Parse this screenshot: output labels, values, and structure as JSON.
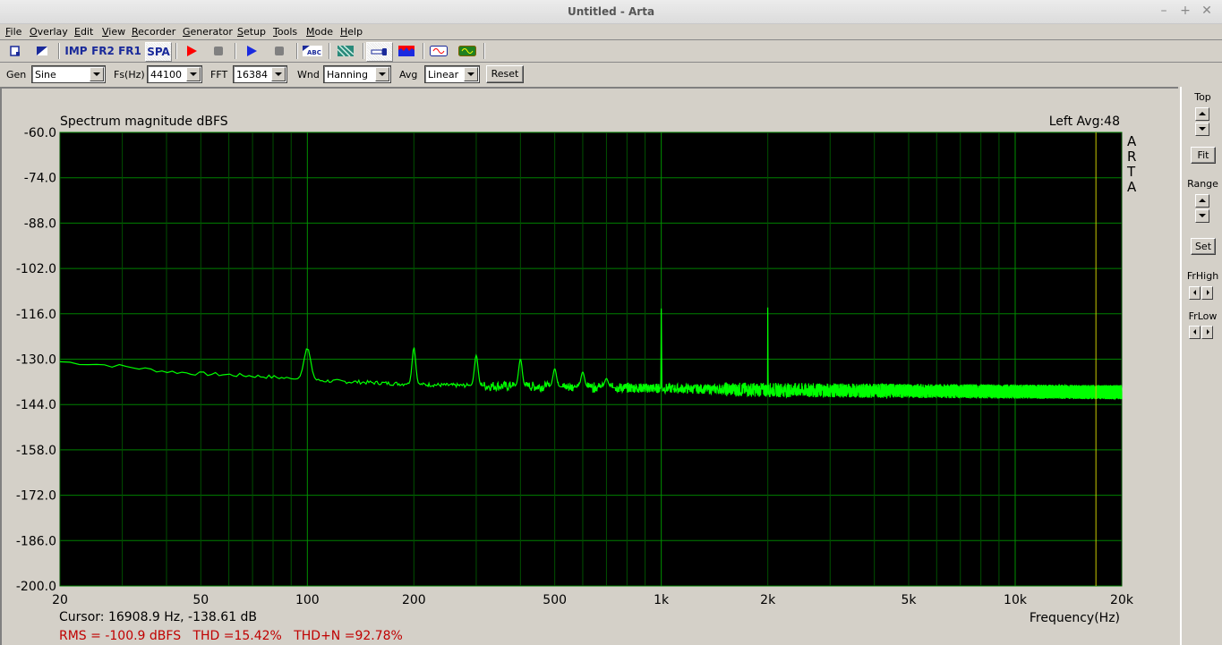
{
  "window": {
    "title": "Untitled - Arta",
    "controls": {
      "minimize": "–",
      "maximize": "+",
      "close": "✕"
    }
  },
  "menu": [
    {
      "label": "File",
      "accel": "F"
    },
    {
      "label": "Overlay",
      "accel": "O"
    },
    {
      "label": "Edit",
      "accel": "E"
    },
    {
      "label": "View",
      "accel": "V"
    },
    {
      "label": "Recorder",
      "accel": "R"
    },
    {
      "label": "Generator",
      "accel": "G"
    },
    {
      "label": "Setup",
      "accel": "S"
    },
    {
      "label": "Tools",
      "accel": "T"
    },
    {
      "label": "Mode",
      "accel": "M"
    },
    {
      "label": "Help",
      "accel": "H"
    }
  ],
  "toolbar": {
    "imp_label": "IMP",
    "fr2_label": "FR2",
    "fr1_label": "FR1",
    "spa_label": "SPA",
    "active_mode": "SPA"
  },
  "controls": {
    "gen_label": "Gen",
    "gen_value": "Sine",
    "fs_label": "Fs(Hz)",
    "fs_value": "44100",
    "fft_label": "FFT",
    "fft_value": "16384",
    "wnd_label": "Wnd",
    "wnd_value": "Hanning",
    "avg_label": "Avg",
    "avg_value": "Linear",
    "reset_label": "Reset"
  },
  "side": {
    "top_label": "Top",
    "fit_label": "Fit",
    "range_label": "Range",
    "set_label": "Set",
    "frhigh_label": "FrHigh",
    "frlow_label": "FrLow"
  },
  "status": {
    "cursor": "Cursor: 16908.9 Hz, -138.61 dB",
    "measurements": "RMS = -100.9 dBFS   THD =15.42%   THD+N =92.78%"
  },
  "colors": {
    "trace": "#00ff00",
    "grid": "#006400",
    "cursor": "#c8c800",
    "plot_bg": "#000000",
    "status_red": "#c00000"
  },
  "chart_data": {
    "type": "line",
    "title": "Spectrum magnitude dBFS",
    "channel_info": "Left  Avg:48",
    "watermark": [
      "A",
      "R",
      "T",
      "A"
    ],
    "xlabel": "Frequency(Hz)",
    "ylabel": "",
    "xscale": "log",
    "xlim": [
      20,
      20000
    ],
    "ylim": [
      -200,
      -60
    ],
    "yticks": [
      -60,
      -74,
      -88,
      -102,
      -116,
      -130,
      -144,
      -158,
      -172,
      -186,
      -200
    ],
    "ytick_labels": [
      "-60.0",
      "-74.0",
      "-88.0",
      "-102.0",
      "-116.0",
      "-130.0",
      "-144.0",
      "-158.0",
      "-172.0",
      "-186.0",
      "-200.0"
    ],
    "xticks": [
      20,
      50,
      100,
      200,
      500,
      1000,
      2000,
      5000,
      10000,
      20000
    ],
    "xtick_labels": [
      "20",
      "50",
      "100",
      "200",
      "500",
      "1k",
      "2k",
      "5k",
      "10k",
      "20k"
    ],
    "grid": true,
    "cursor_hz": 16908.9,
    "series": [
      {
        "name": "Left",
        "baseline": [
          [
            20,
            -130.8
          ],
          [
            25,
            -131.5
          ],
          [
            30,
            -132.2
          ],
          [
            40,
            -133.8
          ],
          [
            50,
            -134.5
          ],
          [
            60,
            -134.8
          ],
          [
            80,
            -135.5
          ],
          [
            100,
            -136.5
          ],
          [
            150,
            -137.2
          ],
          [
            200,
            -137.8
          ],
          [
            300,
            -138.2
          ],
          [
            500,
            -138.5
          ],
          [
            1000,
            -139.0
          ],
          [
            2000,
            -139.5
          ],
          [
            5000,
            -139.8
          ],
          [
            10000,
            -140.0
          ],
          [
            20000,
            -140.2
          ]
        ],
        "peaks": [
          {
            "hz": 100,
            "db": -126.5
          },
          {
            "hz": 200,
            "db": -126.3
          },
          {
            "hz": 300,
            "db": -128.8
          },
          {
            "hz": 400,
            "db": -130.0
          },
          {
            "hz": 500,
            "db": -133.0
          },
          {
            "hz": 600,
            "db": -134.0
          },
          {
            "hz": 700,
            "db": -136.0
          },
          {
            "hz": 1000,
            "db": -114.0
          },
          {
            "hz": 2000,
            "db": -113.5
          }
        ]
      }
    ]
  }
}
